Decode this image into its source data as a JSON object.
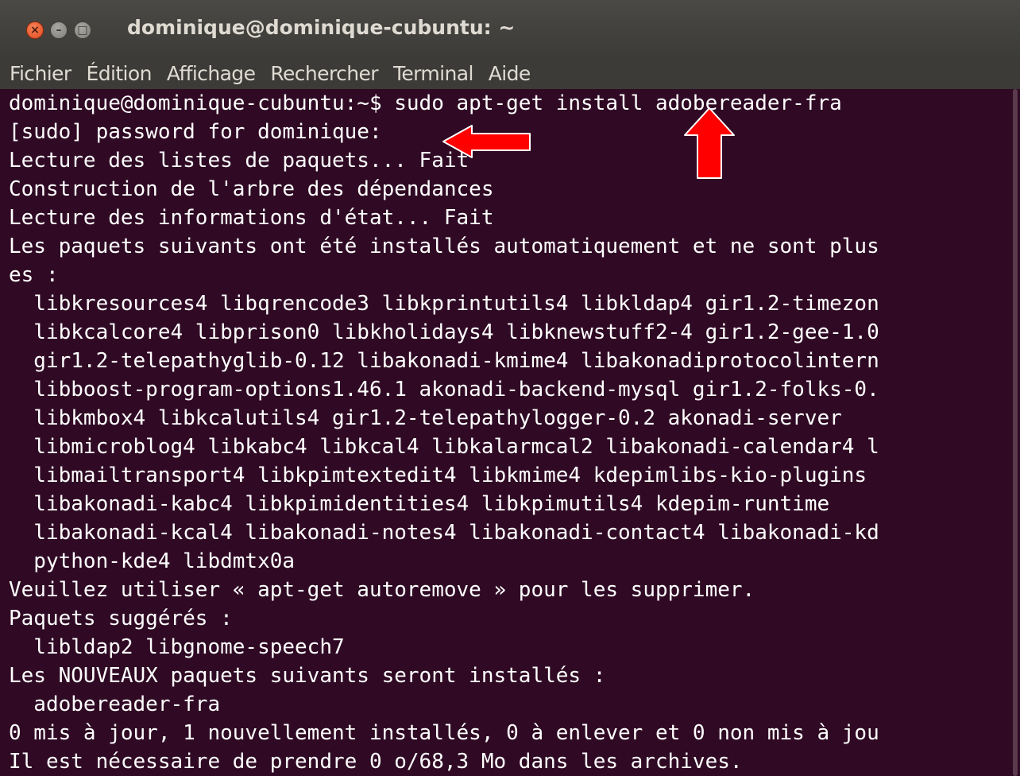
{
  "window": {
    "title": "dominique@dominique-cubuntu: ~",
    "close_glyph": "×",
    "min_glyph": "–",
    "max_glyph": "□"
  },
  "menu": {
    "items": [
      "Fichier",
      "Édition",
      "Affichage",
      "Rechercher",
      "Terminal",
      "Aide"
    ]
  },
  "terminal": {
    "lines": [
      "dominique@dominique-cubuntu:~$ sudo apt-get install adobereader-fra",
      "[sudo] password for dominique:",
      "Lecture des listes de paquets... Fait",
      "Construction de l'arbre des dépendances",
      "Lecture des informations d'état... Fait",
      "Les paquets suivants ont été installés automatiquement et ne sont plus",
      "es :",
      "  libkresources4 libqrencode3 libkprintutils4 libkldap4 gir1.2-timezon",
      "  libkcalcore4 libprison0 libkholidays4 libknewstuff2-4 gir1.2-gee-1.0",
      "  gir1.2-telepathyglib-0.12 libakonadi-kmime4 libakonadiprotocolintern",
      "  libboost-program-options1.46.1 akonadi-backend-mysql gir1.2-folks-0.",
      "  libkmbox4 libkcalutils4 gir1.2-telepathylogger-0.2 akonadi-server",
      "  libmicroblog4 libkabc4 libkcal4 libkalarmcal2 libakonadi-calendar4 l",
      "  libmailtransport4 libkpimtextedit4 libkmime4 kdepimlibs-kio-plugins",
      "  libakonadi-kabc4 libkpimidentities4 libkpimutils4 kdepim-runtime",
      "  libakonadi-kcal4 libakonadi-notes4 libakonadi-contact4 libakonadi-kd",
      "  python-kde4 libdmtx0a",
      "Veuillez utiliser « apt-get autoremove » pour les supprimer.",
      "Paquets suggérés :",
      "  libldap2 libgnome-speech7",
      "Les NOUVEAUX paquets suivants seront installés :",
      "  adobereader-fra",
      "0 mis à jour, 1 nouvellement installés, 0 à enlever et 0 non mis à jou",
      "Il est nécessaire de prendre 0 o/68,3 Mo dans les archives."
    ]
  },
  "colors": {
    "terminal_bg": "#300a24",
    "terminal_fg": "#ffffff",
    "titlebar": "#3c3b37",
    "arrow": "#ff0000"
  }
}
